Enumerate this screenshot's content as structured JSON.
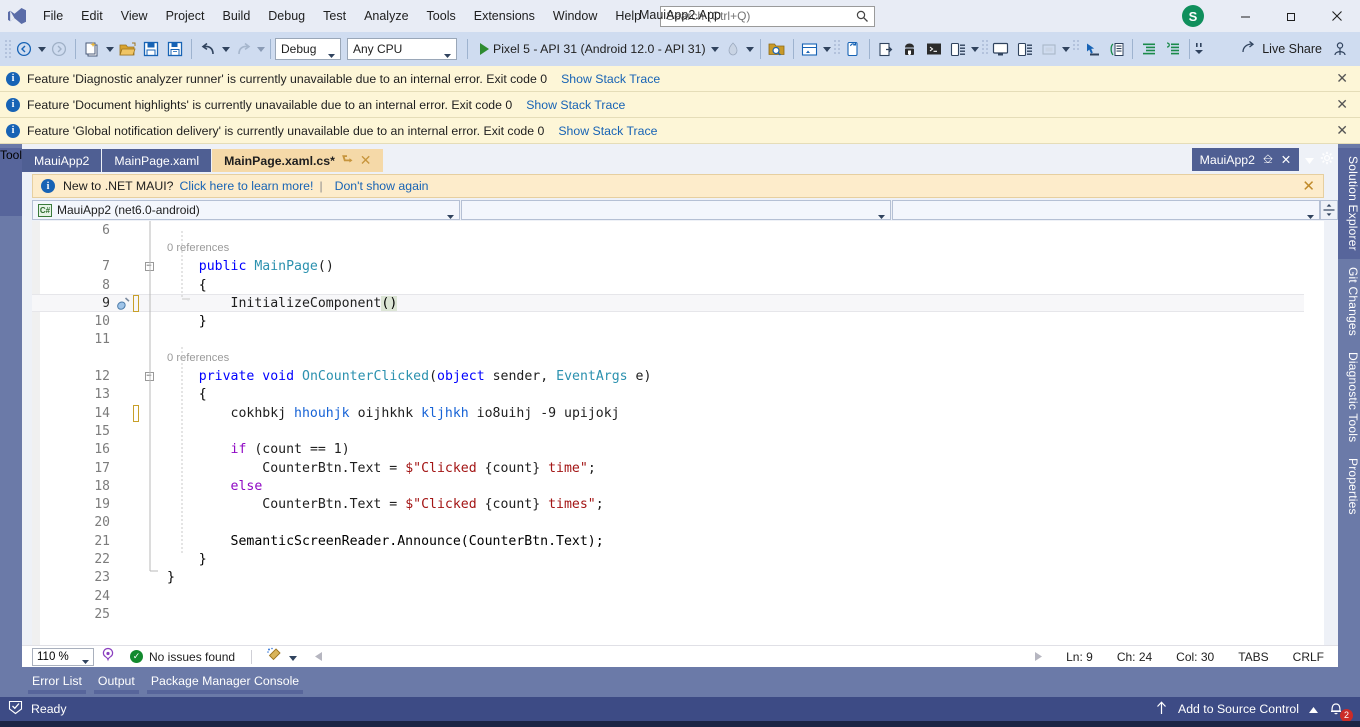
{
  "titlebar": {
    "menus": [
      "File",
      "Edit",
      "View",
      "Project",
      "Build",
      "Debug",
      "Test",
      "Analyze",
      "Tools",
      "Extensions",
      "Window",
      "Help"
    ],
    "search_placeholder": "Search (Ctrl+Q)",
    "window_title": "MauiApp2.App",
    "avatar_letter": "S",
    "minimize_label": "─",
    "restore_label": "❐",
    "close_label": "✕"
  },
  "toolbar": {
    "config_value": "Debug",
    "platform_value": "Any CPU",
    "run_target": "Pixel 5 - API 31 (Android 12.0 - API 31)",
    "live_share": "Live Share"
  },
  "infobars": [
    {
      "text": "Feature 'Diagnostic analyzer runner' is currently unavailable due to an internal error. Exit code 0",
      "link": "Show Stack Trace"
    },
    {
      "text": "Feature 'Document highlights' is currently unavailable due to an internal error. Exit code 0",
      "link": "Show Stack Trace"
    },
    {
      "text": "Feature 'Global notification delivery' is currently unavailable due to an internal error. Exit code 0",
      "link": "Show Stack Trace"
    }
  ],
  "toolbox": {
    "label": "Toolbox"
  },
  "tabs": [
    {
      "label": "MauiApp2",
      "active": false
    },
    {
      "label": "MainPage.xaml",
      "active": false
    },
    {
      "label": "MainPage.xaml.cs*",
      "active": true
    }
  ],
  "docwell_right": {
    "tab_label": "MauiApp2"
  },
  "maui_bar": {
    "text": "New to .NET MAUI?",
    "link1": "Click here to learn more!",
    "separator": "|",
    "link2": "Don't show again"
  },
  "navbars": {
    "project": "MauiApp2 (net6.0-android)",
    "type": "",
    "member": ""
  },
  "editor": {
    "lines": [
      {
        "num": "6",
        "text": ""
      },
      {
        "num": "",
        "lens": "0 references"
      },
      {
        "num": "7",
        "fold": true,
        "text": "    public MainPage()"
      },
      {
        "num": "8",
        "text": "    {"
      },
      {
        "num": "9",
        "text": "        InitializeComponent()",
        "current": true,
        "changed": true,
        "glyph": "screwdriver"
      },
      {
        "num": "10",
        "text": "    }"
      },
      {
        "num": "11",
        "text": ""
      },
      {
        "num": "",
        "lens": "0 references"
      },
      {
        "num": "12",
        "fold": true,
        "text": "    private void OnCounterClicked(object sender, EventArgs e)"
      },
      {
        "num": "13",
        "text": "    {"
      },
      {
        "num": "14",
        "text": "        cokhbkj hhouhjk oijhkhk kljhkh io8uihj -9 upijokj",
        "changed": true
      },
      {
        "num": "15",
        "text": ""
      },
      {
        "num": "16",
        "text": "        if (count == 1)"
      },
      {
        "num": "17",
        "text": "            CounterBtn.Text = $\"Clicked {count} time\";"
      },
      {
        "num": "18",
        "text": "        else"
      },
      {
        "num": "19",
        "text": "            CounterBtn.Text = $\"Clicked {count} times\";"
      },
      {
        "num": "20",
        "text": ""
      },
      {
        "num": "21",
        "text": "        SemanticScreenReader.Announce(CounterBtn.Text);"
      },
      {
        "num": "22",
        "text": "    }"
      },
      {
        "num": "23",
        "text": "}"
      },
      {
        "num": "24",
        "text": ""
      },
      {
        "num": "25",
        "text": ""
      }
    ]
  },
  "editor_status": {
    "zoom": "110 %",
    "issues": "No issues found",
    "ln": "Ln: 9",
    "ch": "Ch: 24",
    "col": "Col: 30",
    "tabs_mode": "TABS",
    "line_ending": "CRLF"
  },
  "right_tabs": [
    {
      "label": "Solution Explorer",
      "selected": true
    },
    {
      "label": "Git Changes",
      "selected": false
    },
    {
      "label": "Diagnostic Tools",
      "selected": false
    },
    {
      "label": "Properties",
      "selected": false
    }
  ],
  "bottom_tabs": [
    "Error List",
    "Output",
    "Package Manager Console"
  ],
  "statusbar": {
    "state": "Ready",
    "source_control": "Add to Source Control",
    "notification_count": "2"
  },
  "colors": {
    "accent_chrome": "#6b7aa8",
    "toolbar_bg": "#cfdcf0",
    "active_tab": "#f5d9a8",
    "infobar_bg": "#fdf6d7",
    "link": "#1763b5",
    "status_bar": "#3d4b85"
  }
}
